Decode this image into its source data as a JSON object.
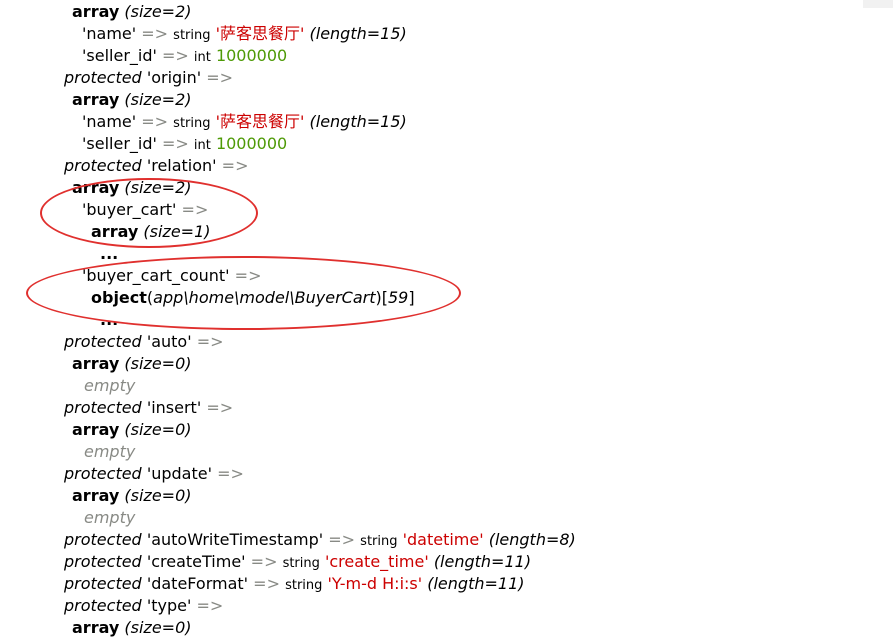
{
  "colors": {
    "string_value": "#cc0000",
    "int_value": "#4e9a06",
    "arrow": "#888a85",
    "empty": "#888a85",
    "annotation": "#e0302e"
  },
  "arrow": "=>",
  "lines": [
    {
      "kw": "array",
      "meta": "(size=2)"
    },
    {
      "key": "'name'",
      "type": "string",
      "str": "'萨客思餐厅'",
      "meta": "(length=15)"
    },
    {
      "key": "'seller_id'",
      "type": "int",
      "num": "1000000"
    },
    {
      "prot": "protected",
      "key": "'origin'"
    },
    {
      "kw": "array",
      "meta": "(size=2)"
    },
    {
      "key": "'name'",
      "type": "string",
      "str": "'萨客思餐厅'",
      "meta": "(length=15)"
    },
    {
      "key": "'seller_id'",
      "type": "int",
      "num": "1000000"
    },
    {
      "prot": "protected",
      "key": "'relation'"
    },
    {
      "kw": "array",
      "meta": "(size=2)"
    },
    {
      "key": "'buyer_cart'"
    },
    {
      "kw": "array",
      "meta": "(size=1)"
    },
    {
      "ellipsis": "..."
    },
    {
      "key": "'buyer_cart_count'"
    },
    {
      "kw": "object",
      "obj_class": "app\\home\\model\\BuyerCart",
      "obj_id": "59"
    },
    {
      "ellipsis": "..."
    },
    {
      "prot": "protected",
      "key": "'auto'"
    },
    {
      "kw": "array",
      "meta": "(size=0)"
    },
    {
      "empty": "empty"
    },
    {
      "prot": "protected",
      "key": "'insert'"
    },
    {
      "kw": "array",
      "meta": "(size=0)"
    },
    {
      "empty": "empty"
    },
    {
      "prot": "protected",
      "key": "'update'"
    },
    {
      "kw": "array",
      "meta": "(size=0)"
    },
    {
      "empty": "empty"
    },
    {
      "prot": "protected",
      "key": "'autoWriteTimestamp'",
      "type": "string",
      "str": "'datetime'",
      "meta": "(length=8)"
    },
    {
      "prot": "protected",
      "key": "'createTime'",
      "type": "string",
      "str": "'create_time'",
      "meta": "(length=11)"
    },
    {
      "prot": "protected",
      "key": "'dateFormat'",
      "type": "string",
      "str": "'Y-m-d H:i:s'",
      "meta": "(length=11)"
    },
    {
      "prot": "protected",
      "key": "'type'"
    },
    {
      "kw": "array",
      "meta": "(size=0)"
    }
  ]
}
